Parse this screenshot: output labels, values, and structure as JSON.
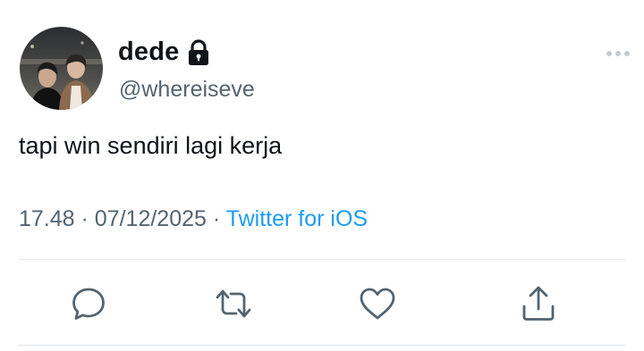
{
  "author": {
    "display_name": "dede",
    "handle": "@whereiseve",
    "protected_icon": "lock-icon",
    "avatar": "profile-photo"
  },
  "tweet": {
    "text": "tapi win sendiri lagi kerja"
  },
  "meta": {
    "time": "17.48",
    "separator": "·",
    "date": "07/12/2025",
    "source": "Twitter for iOS"
  },
  "actions": {
    "reply_icon": "reply-icon",
    "retweet_icon": "retweet-icon",
    "like_icon": "heart-icon",
    "share_icon": "share-icon"
  },
  "colors": {
    "text": "#0f1419",
    "secondary": "#536471",
    "link": "#1d9bf0",
    "divider": "#e1e5e8"
  }
}
